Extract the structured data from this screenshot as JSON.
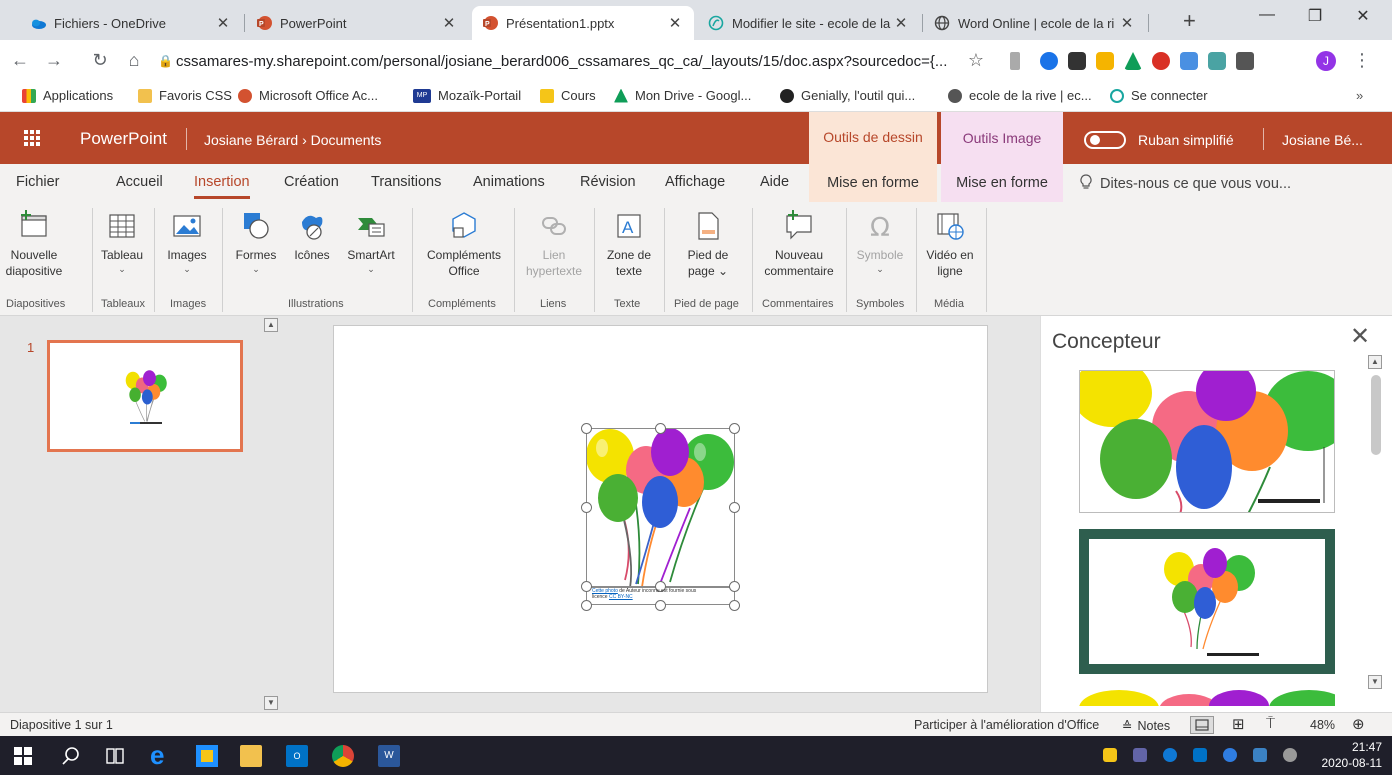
{
  "browser": {
    "tabs": [
      {
        "title": "Fichiers - OneDrive",
        "active": false
      },
      {
        "title": "PowerPoint",
        "active": false
      },
      {
        "title": "Présentation1.pptx",
        "active": true
      },
      {
        "title": "Modifier le site - ecole de la ri",
        "active": false
      },
      {
        "title": "Word Online | ecole de la ri",
        "active": false
      }
    ],
    "url": "cssamares-my.sharepoint.com/personal/josiane_berard006_cssamares_qc_ca/_layouts/15/doc.aspx?sourcedoc={...",
    "bookmarks": [
      "Applications",
      "Favoris CSS",
      "Microsoft Office Ac...",
      "Mozaïk-Portail",
      "Cours",
      "Mon Drive - Googl...",
      "Genially, l'outil qui...",
      "ecole de la rive | ec...",
      "Se connecter"
    ],
    "bookmarks_more": "»",
    "profile_initial": "J"
  },
  "app": {
    "name": "PowerPoint",
    "user_path": "Josiane Bérard",
    "folder": "Documents",
    "breadcrumb_sep": "›",
    "context_group_1": "Outils de dessin",
    "context_group_2": "Outils Image",
    "simplified_ribbon": "Ruban simplifié",
    "user_name": "Josiane Bé..."
  },
  "ribbon_tabs": [
    "Fichier",
    "Accueil",
    "Insertion",
    "Création",
    "Transitions",
    "Animations",
    "Révision",
    "Affichage",
    "Aide"
  ],
  "active_tab": "Insertion",
  "context_tab_1": "Mise en forme",
  "context_tab_2": "Mise en forme",
  "tell_me": "Dites-nous ce que vous vou...",
  "ribbon": {
    "buttons": [
      {
        "l1": "Nouvelle",
        "l2": "diapositive"
      },
      {
        "l1": "Tableau",
        "l2": "⌄"
      },
      {
        "l1": "Images",
        "l2": "⌄"
      },
      {
        "l1": "Formes",
        "l2": "⌄"
      },
      {
        "l1": "Icônes",
        "l2": ""
      },
      {
        "l1": "SmartArt",
        "l2": "⌄"
      },
      {
        "l1": "Compléments",
        "l2": "Office"
      },
      {
        "l1": "Lien",
        "l2": "hypertexte"
      },
      {
        "l1": "Zone de",
        "l2": "texte"
      },
      {
        "l1": "Pied de",
        "l2": "page ⌄"
      },
      {
        "l1": "Nouveau",
        "l2": "commentaire"
      },
      {
        "l1": "Symbole",
        "l2": "⌄"
      },
      {
        "l1": "Vidéo en",
        "l2": "ligne"
      }
    ],
    "groups": [
      "Diapositives",
      "Tableaux",
      "Images",
      "Illustrations",
      "Compléments",
      "Liens",
      "Texte",
      "Pied de page",
      "Commentaires",
      "Symboles",
      "Média"
    ]
  },
  "slides": {
    "current_number": "1"
  },
  "caption": {
    "link1": "Cette photo",
    "mid": " de Auteur inconnu est fournie sous",
    "pre2": "licence ",
    "link2": "CC BY-NC"
  },
  "designer": {
    "title": "Concepteur"
  },
  "status": {
    "slide_info": "Diapositive 1 sur 1",
    "feedback": "Participer à l'amélioration d'Office",
    "notes": "Notes",
    "zoom": "48%"
  },
  "taskbar": {
    "time": "21:47",
    "date": "2020-08-11"
  },
  "colors": {
    "ppt_accent": "#b7472a",
    "thumb_selection": "#e3754f",
    "designer_frame": "#2e5e4e"
  }
}
